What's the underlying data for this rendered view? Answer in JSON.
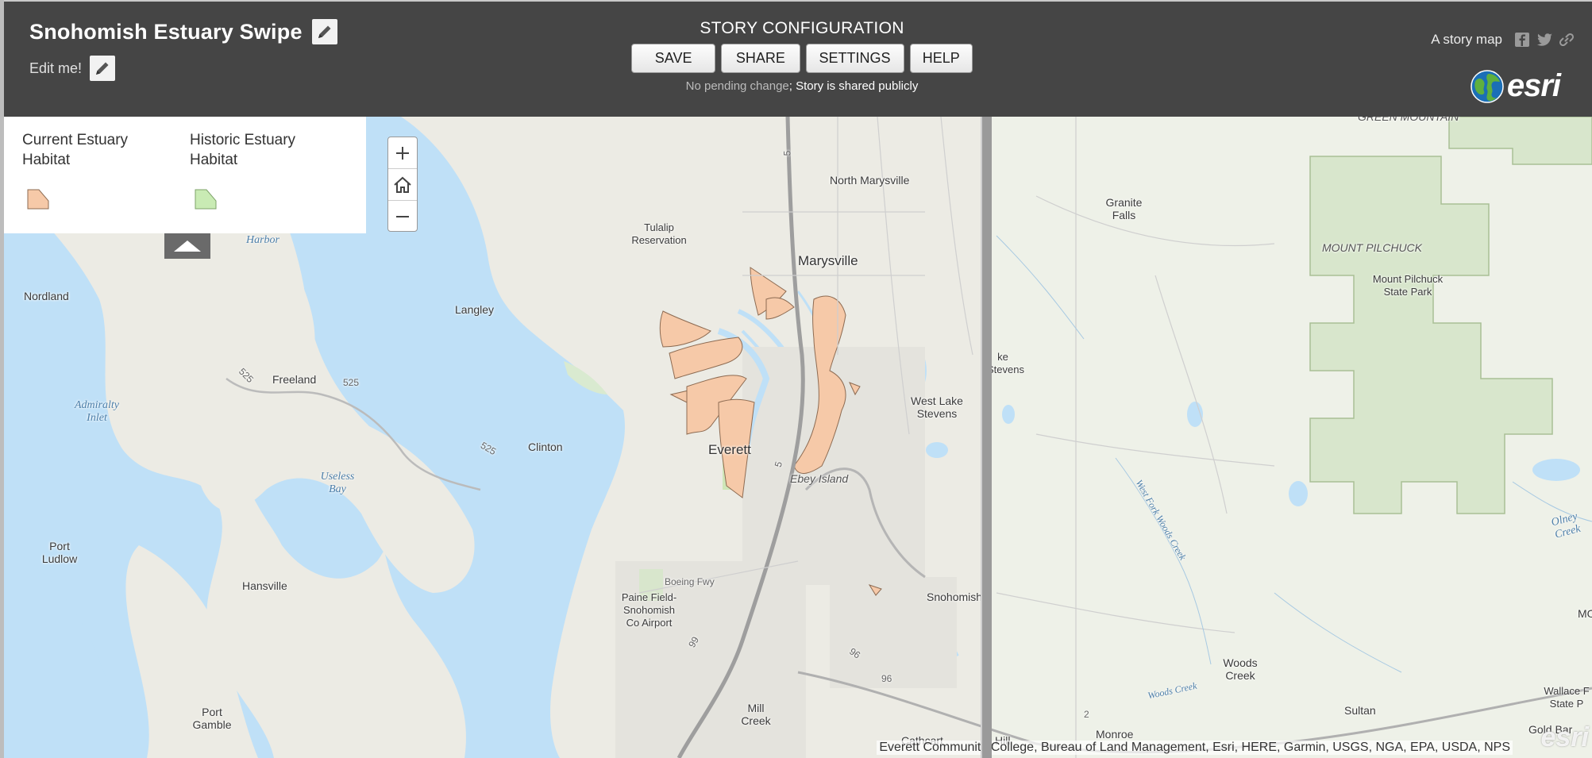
{
  "header": {
    "title": "Snohomish Estuary Swipe",
    "subtitle": "Edit me!",
    "builder_title": "STORY CONFIGURATION",
    "buttons": {
      "save": "SAVE",
      "share": "SHARE",
      "settings": "SETTINGS",
      "help": "HELP"
    },
    "status_pending": "No pending change",
    "status_shared": "; Story is shared publicly",
    "share_text": "A story map",
    "logo_text": "esri"
  },
  "legend": {
    "items": [
      {
        "label": "Current Estuary Habitat",
        "color": "#f6c9a8"
      },
      {
        "label": "Historic Estuary Habitat",
        "color": "#c9ebb4"
      }
    ]
  },
  "map": {
    "labels": {
      "north_marysville": "North Marysville",
      "tulalip": "Tulalip Reservation",
      "marysville": "Marysville",
      "harbor": "Harbor",
      "nordland": "Nordland",
      "langley": "Langley",
      "freeland": "Freeland",
      "admiralty": "Admiralty Inlet",
      "clinton": "Clinton",
      "everett": "Everett",
      "ebey": "Ebey Island",
      "west_lake_stevens": "West Lake Stevens",
      "ke_stevens": "ke Stevens",
      "useless_bay": "Useless Bay",
      "port_ludlow": "Port Ludlow",
      "hansville": "Hansville",
      "boeing": "Boeing Fwy",
      "paine": "Paine Field-Snohomish Co Airport",
      "snohomish": "Snohomish",
      "port_gamble": "Port Gamble",
      "mill_creek": "Mill Creek",
      "cathcart": "Cathcart",
      "mill_hill": "Hill",
      "granite": "Granite Falls",
      "mount_pilchuck": "MOUNT PILCHUCK",
      "pilchuck_park": "Mount Pilchuck State Park",
      "green_mountain": "GREEN MOUNTAIN",
      "woods_creek": "Woods Creek",
      "sultan": "Sultan",
      "monroe": "Monroe",
      "wallace": "Wallace F State P",
      "gold_bar": "Gold Bar",
      "olney": "Olney Creek",
      "wf_woods": "West Fork Woods Creek",
      "woods_creek_river": "Woods Creek",
      "mo": "MO",
      "r5_top": "5",
      "r5_mid": "5",
      "r525a": "525",
      "r525b": "525",
      "r525c": "525",
      "r96a": "96",
      "r96b": "96",
      "r99": "99",
      "r2": "2"
    },
    "attribution": "Everett Community College, Bureau of Land Management, Esri, HERE, Garmin, USGS, NGA, EPA, USDA, NPS",
    "watermark": "esri"
  }
}
